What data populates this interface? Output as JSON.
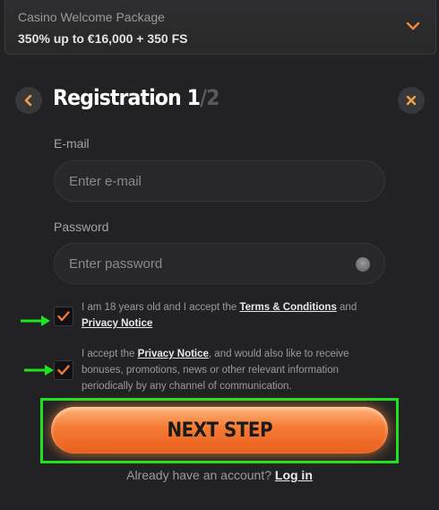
{
  "welcome": {
    "label": "Casino Welcome Package",
    "offer": "350% up to €16,000 + 350 FS",
    "chevron_icon": "chevron-down-icon"
  },
  "header": {
    "title_main": "Registration 1",
    "title_total": "/2",
    "back_icon": "chevron-left-icon",
    "close_icon": "close-icon"
  },
  "form": {
    "email": {
      "label": "E-mail",
      "placeholder": "Enter e-mail",
      "value": ""
    },
    "password": {
      "label": "Password",
      "placeholder": "Enter password",
      "value": "",
      "eye_icon": "eye-icon"
    }
  },
  "consents": [
    {
      "checked": true,
      "text_before": "I am 18 years old and I accept the ",
      "link1": "Terms & Conditions",
      "text_mid": " and ",
      "link2": "Privacy Notice",
      "text_after": ""
    },
    {
      "checked": true,
      "text_before": "I accept the ",
      "link1": "Privacy Notice",
      "text_after": ", and would also like to receive bonuses, promotions, news or other relevant information periodically by any channel of communication."
    }
  ],
  "next_button": {
    "label": "NEXT STEP"
  },
  "login": {
    "text": "Already have an account? ",
    "link": "Log in"
  },
  "colors": {
    "accent": "#f47a33",
    "highlight": "#1fe31f",
    "background": "#222224"
  }
}
